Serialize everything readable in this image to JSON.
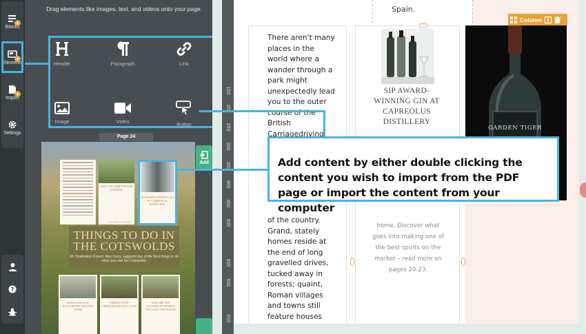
{
  "rail": {
    "blocks_label": "Blocks",
    "elements_label": "Elements",
    "import_label": "Import",
    "settings_label": "Settings"
  },
  "panel": {
    "hint": "Drag elements like images, text, and videos onto your page.",
    "elements": [
      {
        "label": "Header",
        "icon": "header-icon"
      },
      {
        "label": "Paragraph",
        "icon": "paragraph-icon"
      },
      {
        "label": "Link",
        "icon": "link-icon"
      },
      {
        "label": "Image",
        "icon": "image-icon"
      },
      {
        "label": "Video",
        "icon": "video-icon"
      },
      {
        "label": "Button",
        "icon": "button-icon"
      }
    ],
    "page_tag": "Page 24",
    "add_label": "Add"
  },
  "thumbnail": {
    "title": "THINGS TO DO IN THE COTSWOLDS",
    "byline": "BY ALEX CURRY",
    "subtitle": "UK Destination Expert, Alex Curry, suggests five of the best things to do when you visit the Cotswolds.",
    "captions": [
      "VISIT THE ABBEY HOUSE GARDENS",
      "SIP AWARD-WINNING GIN AT CAPREOLUS DISTILLERY",
      "HAVE LUNCH AT DAYLESFORD ORGANIC FARM",
      "SADDLE UP AT CIRENCESTER POLO CLUB",
      "EXPLORE THE COTSWOLDS' HIDDEN VILLAGES AND TOWNS"
    ]
  },
  "ruler": {
    "ticks": [
      "150",
      "200",
      "250",
      "300",
      "350",
      "400",
      "450",
      "500",
      "550",
      "600",
      "650"
    ]
  },
  "page": {
    "top_text": "Spain.",
    "col1_text": "There aren't many places in the world where a wander through a park might unexpectedly lead you to the outer course of the British Carriagedriving National",
    "col1_text_b": "of the country. Grand, stately homes reside at the end of long gravelled drives, tucked away in forests; quaint, Roman villages and towns still feature houses warped with",
    "col2_caption": "SIP AWARD-WINNING GIN AT CAPREOLUS DISTILLERY",
    "col2_text": "home. Discover what goes into making one of the best spirits on the market – read more on pages 20-23.",
    "bottle_label": "GARDEN TIGER",
    "column_tool_label": "Column"
  },
  "callout": {
    "text": "Add content by either double clicking the content you wish to import from the PDF page or import the content from your computer"
  },
  "colors": {
    "accent_blue": "#49b2e3",
    "add_green": "#47b286",
    "badge_orange": "#e9a23b",
    "panel_bg": "#474d50"
  }
}
